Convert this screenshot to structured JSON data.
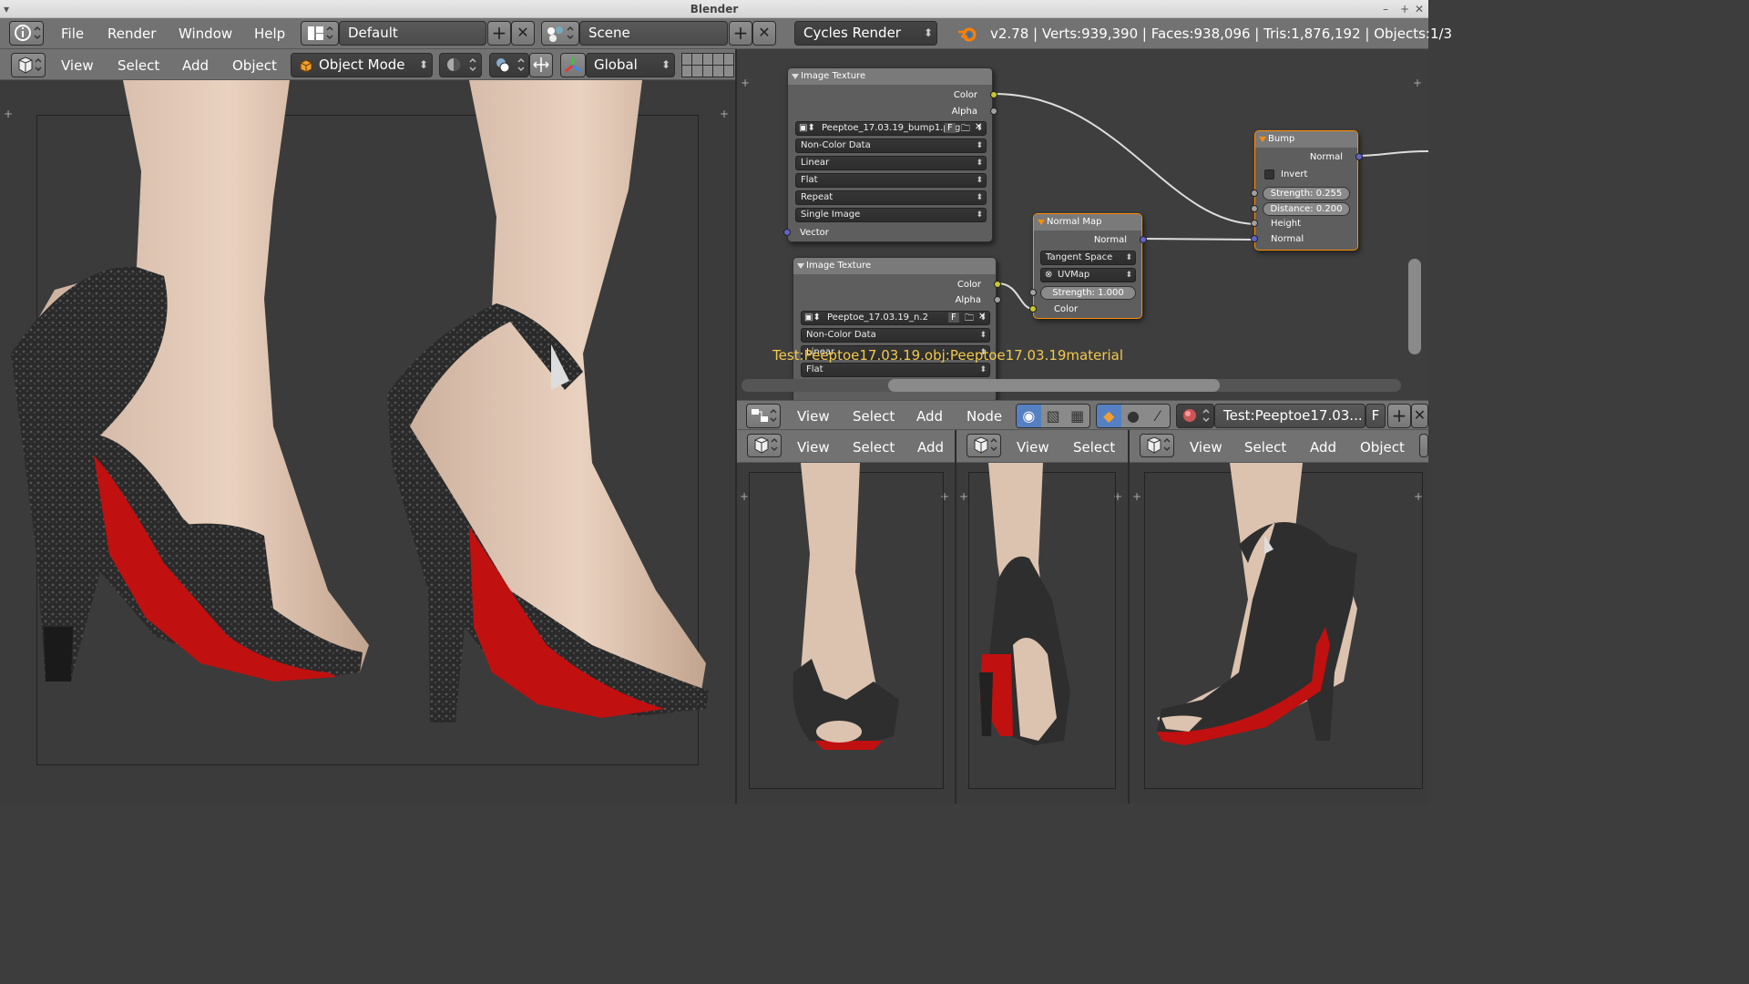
{
  "window": {
    "title": "Blender"
  },
  "info_bar": {
    "menus": [
      "File",
      "Render",
      "Window",
      "Help"
    ],
    "layout": "Default",
    "scene": "Scene",
    "engine": "Cycles Render",
    "stats": "v2.78 | Verts:939,390 | Faces:938,096 | Tris:1,876,192 | Objects:1/3"
  },
  "view3d_main": {
    "menus": [
      "View",
      "Select",
      "Add",
      "Object"
    ],
    "mode": "Object Mode",
    "orientation": "Global"
  },
  "node_editor": {
    "material_label": "Test:Peeptoe17.03.19.obj:Peeptoe17.03.19material",
    "header": {
      "menus": [
        "View",
        "Select",
        "Add",
        "Node"
      ],
      "material": "Test:Peeptoe17.03...",
      "fake_user": "F"
    },
    "image_texture_1": {
      "title": "Image Texture",
      "out_color": "Color",
      "out_alpha": "Alpha",
      "image": "Peeptoe_17.03.19_bump1.png",
      "f": "F",
      "color_space": "Non-Color Data",
      "interpolation": "Linear",
      "projection": "Flat",
      "extension": "Repeat",
      "source": "Single Image",
      "in_vector": "Vector"
    },
    "image_texture_2": {
      "title": "Image Texture",
      "out_color": "Color",
      "out_alpha": "Alpha",
      "image": "Peeptoe_17.03.19_n.2",
      "f": "F",
      "color_space": "Non-Color Data",
      "interpolation": "Linear",
      "projection": "Flat"
    },
    "normal_map": {
      "title": "Normal Map",
      "out_normal": "Normal",
      "space": "Tangent Space",
      "uv_map": "UVMap",
      "strength": "Strength:    1.000",
      "in_color": "Color"
    },
    "bump": {
      "title": "Bump",
      "out_normal": "Normal",
      "invert": "Invert",
      "strength": "Strength:   0.255",
      "distance": "Distance:  0.200",
      "in_height": "Height",
      "in_normal": "Normal"
    }
  },
  "mini_views": [
    {
      "menus": [
        "View",
        "Select",
        "Add"
      ]
    },
    {
      "menus": [
        "View",
        "Select"
      ]
    },
    {
      "menus": [
        "View",
        "Select",
        "Add",
        "Object"
      ]
    }
  ],
  "colors": {
    "accent": "#ff8c00",
    "socket_color": "#c7c729",
    "socket_vector": "#6363c7",
    "label_yellow": "#f2c94c",
    "sole_red": "#c01010"
  }
}
